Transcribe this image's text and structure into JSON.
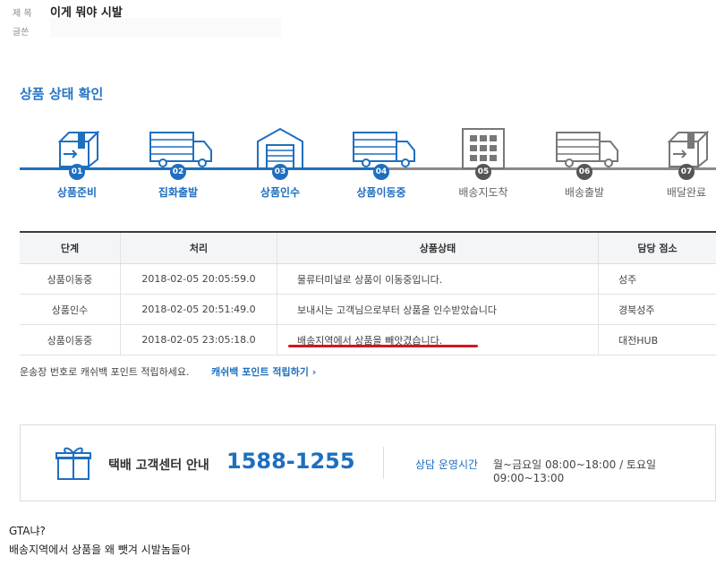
{
  "post": {
    "title_label": "제 목",
    "title": "이게 뭐야 시발",
    "author_label": "글쓴"
  },
  "tracking": {
    "section_title": "상품 상태 확인",
    "steps": [
      {
        "num": "01",
        "label": "상품준비",
        "done": true,
        "icon": "box-arrow-icon"
      },
      {
        "num": "02",
        "label": "집화출발",
        "done": true,
        "icon": "truck-icon"
      },
      {
        "num": "03",
        "label": "상품인수",
        "done": true,
        "icon": "warehouse-icon"
      },
      {
        "num": "04",
        "label": "상품이동중",
        "done": true,
        "icon": "truck-icon"
      },
      {
        "num": "05",
        "label": "배송지도착",
        "done": false,
        "icon": "building-icon"
      },
      {
        "num": "06",
        "label": "배송출발",
        "done": false,
        "icon": "truck-icon"
      },
      {
        "num": "07",
        "label": "배달완료",
        "done": false,
        "icon": "box-arrow-icon"
      }
    ],
    "table": {
      "headers": [
        "단계",
        "처리",
        "상품상태",
        "담당 점소"
      ],
      "rows": [
        {
          "stage": "상품이동중",
          "time": "2018-02-05 20:05:59.0",
          "status": "물류터미널로 상품이 이동중입니다.",
          "office": "성주"
        },
        {
          "stage": "상품인수",
          "time": "2018-02-05 20:51:49.0",
          "status": "보내시는 고객님으로부터 상품을 인수받았습니다",
          "office": "경북성주"
        },
        {
          "stage": "상품이동중",
          "time": "2018-02-05 23:05:18.0",
          "status": "배송지역에서 상품을 빼앗겼습니다.",
          "office": "대전HUB"
        }
      ]
    },
    "cashback_text": "운송장 번호로 캐쉬백 포인트 적립하세요.",
    "cashback_link": "캐쉬백 포인트 적립하기 ›"
  },
  "contact": {
    "label": "택배 고객센터 안내",
    "phone": "1588-1255",
    "hours_label": "상담 운영시간",
    "hours": "월~금요일 08:00~18:00 / 토요일 09:00~13:00",
    "icon": "gift-box-icon"
  },
  "comment": {
    "line1": "GTA냐?",
    "line2": "배송지역에서 상품을 왜 뺏겨 시발놈들아"
  },
  "colors": {
    "accent": "#1e6fbf",
    "track_done": "#1e6fbf",
    "track_todo": "#777777",
    "highlight_underline": "#d8141e"
  }
}
